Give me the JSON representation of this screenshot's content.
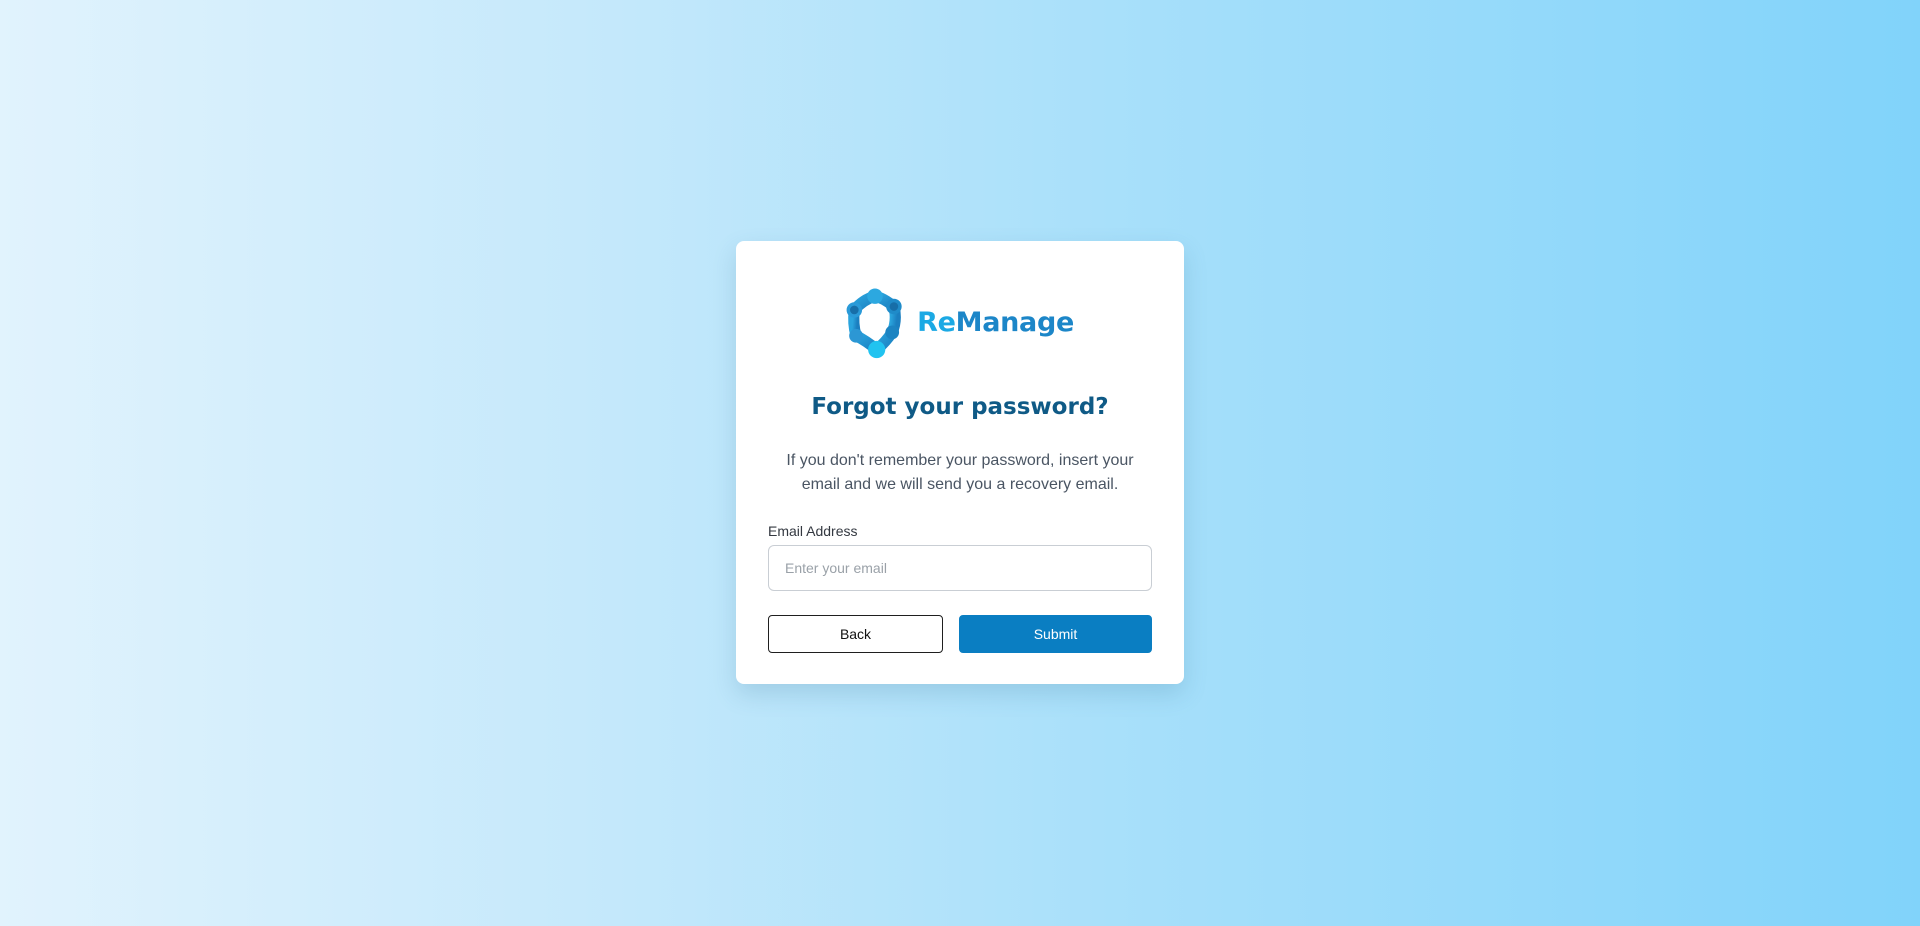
{
  "logo": {
    "icon": "remanage-molecule-logo-icon",
    "text_part1": "Re",
    "text_part2": "Manage"
  },
  "title": "Forgot your password?",
  "description": "If you don't remember your password, insert your email and we will send you a recovery email.",
  "email": {
    "label": "Email Address",
    "placeholder": "Enter your email",
    "value": ""
  },
  "buttons": {
    "back": "Back",
    "submit": "Submit"
  },
  "colors": {
    "title": "#0f5a86",
    "primary": "#0a7ec2",
    "logo_light": "#1ba9e4",
    "logo_dark": "#1c86c8"
  }
}
